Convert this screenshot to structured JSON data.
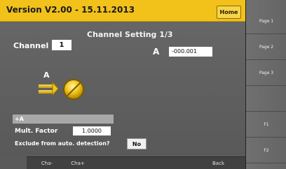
{
  "header": {
    "version": "Version V2.00 - 15.11.2013",
    "home_label": "Home"
  },
  "page": {
    "title": "Channel Setting 1/3",
    "channel_label": "Channel",
    "channel_value": "1",
    "a_label": "A",
    "a_value": "-000.001",
    "sensor_icon": "sensor-icon"
  },
  "settings": {
    "section_label": "+A",
    "mult_factor_label": "Mult. Factor",
    "mult_factor_value": "1.0000",
    "exclude_label": "Exclude from auto. detection?",
    "exclude_value": "No"
  },
  "bottom": {
    "cha_minus": "Cha-",
    "cha_plus": "Cha+",
    "back": "Back"
  },
  "sidebar": {
    "items": [
      {
        "label": "Page 1"
      },
      {
        "label": "Page 2"
      },
      {
        "label": "Page 3"
      },
      {
        "label": ""
      },
      {
        "label": "F1"
      },
      {
        "label": "F2"
      }
    ]
  },
  "colors": {
    "top_bar": "#f2c21b",
    "panel": "#5f5f5f",
    "accent": "#d5a900"
  }
}
